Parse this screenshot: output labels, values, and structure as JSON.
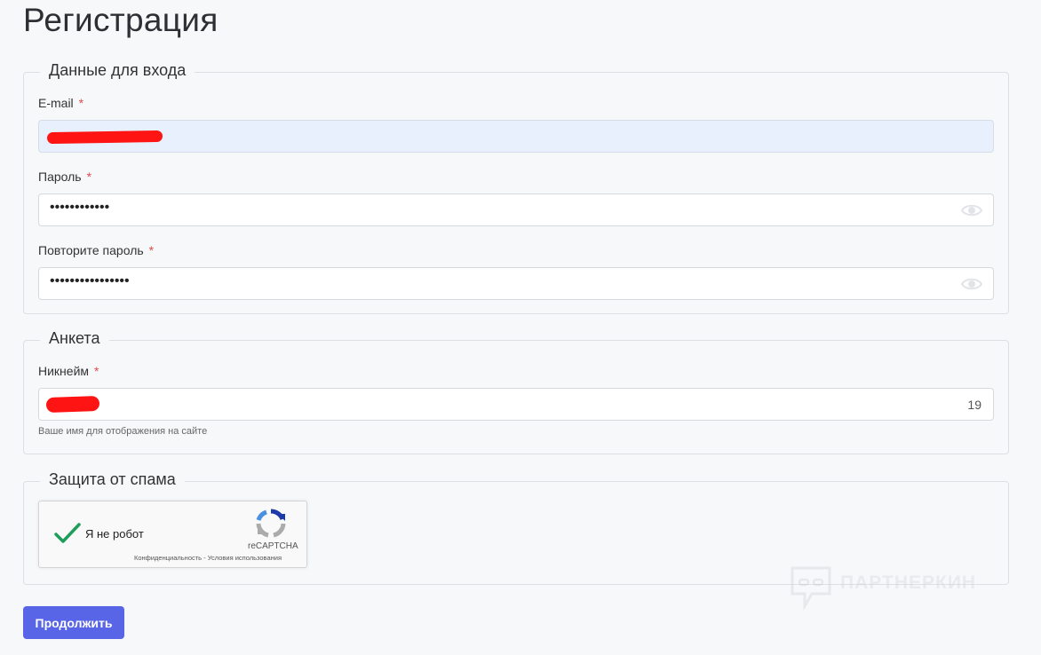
{
  "page": {
    "title": "Регистрация"
  },
  "login_section": {
    "legend": "Данные для входа",
    "email": {
      "label": "E-mail",
      "required_mark": "*",
      "value": ""
    },
    "password": {
      "label": "Пароль",
      "required_mark": "*",
      "masked_value": "••••••••••••",
      "toggle_icon": "eye-icon"
    },
    "password_repeat": {
      "label": "Повторите пароль",
      "required_mark": "*",
      "masked_value": "••••••••••••••••",
      "toggle_icon": "eye-icon"
    }
  },
  "profile_section": {
    "legend": "Анкета",
    "nickname": {
      "label": "Никнейм",
      "required_mark": "*",
      "value": "",
      "char_counter": "19",
      "hint": "Ваше имя для отображения на сайте"
    }
  },
  "spam_section": {
    "legend": "Защита от спама",
    "captcha": {
      "checked": true,
      "label": "Я не робот",
      "brand": "reCAPTCHA",
      "privacy_link": "Конфиденциальность",
      "separator": "-",
      "terms_link": "Условия использования"
    }
  },
  "actions": {
    "continue_label": "Продолжить"
  },
  "watermark": {
    "text": "ПАРТНЕРКИН"
  },
  "colors": {
    "accent": "#5865e6",
    "required": "#e14b4b",
    "autofill_bg": "#e8f0fe",
    "check_green": "#1e9e5a"
  }
}
